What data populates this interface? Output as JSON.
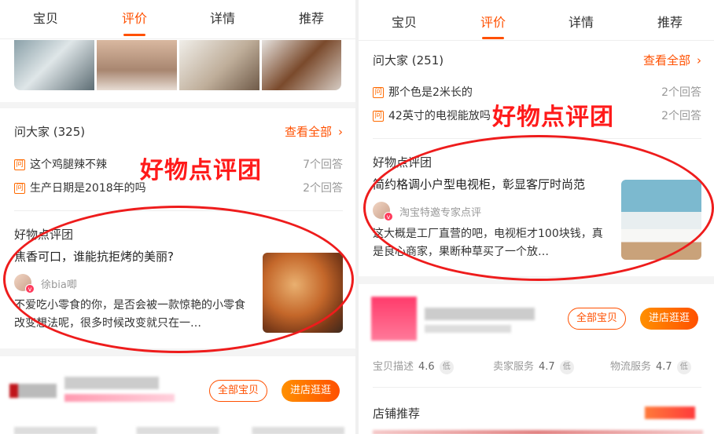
{
  "colors": {
    "accent": "#ff5000",
    "annotation": "#ee1c1c"
  },
  "left": {
    "tabs": [
      {
        "label": "宝贝",
        "active": false
      },
      {
        "label": "评价",
        "active": true
      },
      {
        "label": "详情",
        "active": false
      },
      {
        "label": "推荐",
        "active": false
      }
    ],
    "ask": {
      "title": "问大家 (325)",
      "see_all": "查看全部",
      "questions": [
        {
          "badge": "问",
          "text": "这个鸡腿辣不辣",
          "answers": "7个回答"
        },
        {
          "badge": "问",
          "text": "生产日期是2018年的吗",
          "answers": "2个回答"
        }
      ]
    },
    "pick": {
      "section_title": "好物点评团",
      "headline": "焦香可口，谁能抗拒烤的美丽?",
      "author": "徐bia唧",
      "excerpt": "不爱吃小零食的你，是否会被一款惊艳的小零食改变想法呢，很多时候改变就只在一…"
    },
    "watermark": "好物点评团",
    "shop": {
      "all_items": "全部宝贝",
      "enter_store": "进店逛逛"
    }
  },
  "right": {
    "tabs": [
      {
        "label": "宝贝",
        "active": false
      },
      {
        "label": "评价",
        "active": true
      },
      {
        "label": "详情",
        "active": false
      },
      {
        "label": "推荐",
        "active": false
      }
    ],
    "ask": {
      "title": "问大家 (251)",
      "see_all": "查看全部",
      "questions": [
        {
          "badge": "问",
          "text": "那个色是2米长的",
          "answers": "2个回答"
        },
        {
          "badge": "问",
          "text": "42英寸的电视能放吗",
          "answers": "2个回答"
        }
      ]
    },
    "pick": {
      "section_title": "好物点评团",
      "headline": "简约格调小户型电视柜，彰显客厅时尚范",
      "author": "淘宝特邀专家点评",
      "excerpt": "这大概是工厂直营的吧，电视柜才100块钱，真是良心商家，果断种草买了一个放…"
    },
    "watermark": "好物点评团",
    "shop": {
      "all_items": "全部宝贝",
      "enter_store": "进店逛逛",
      "ratings": [
        {
          "label": "宝贝描述",
          "value": "4.6",
          "level": "低"
        },
        {
          "label": "卖家服务",
          "value": "4.7",
          "level": "低"
        },
        {
          "label": "物流服务",
          "value": "4.7",
          "level": "低"
        }
      ],
      "recommend_title": "店铺推荐"
    }
  }
}
